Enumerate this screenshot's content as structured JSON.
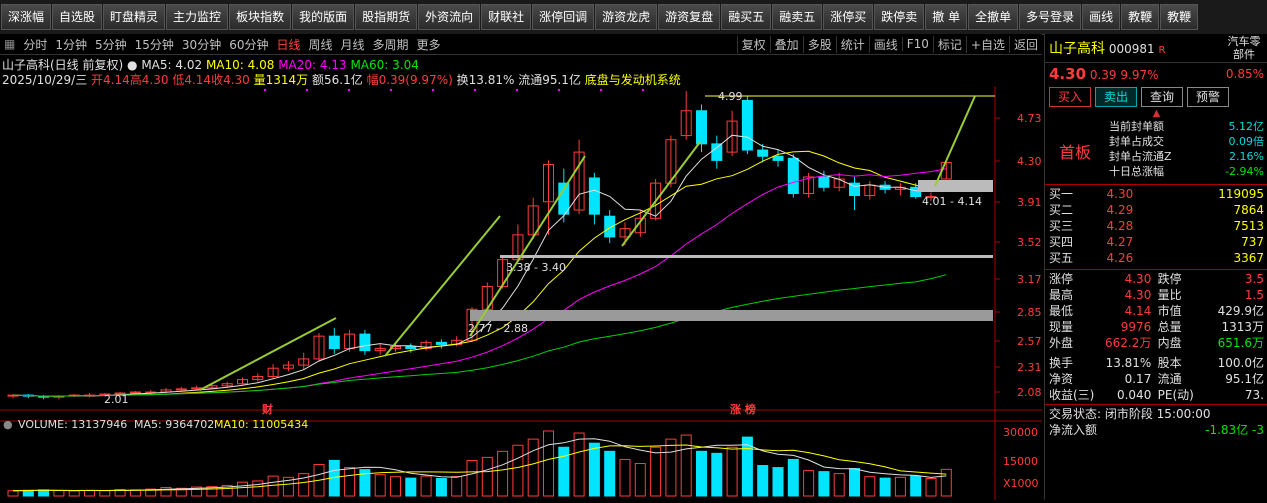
{
  "toolbar": [
    "深涨幅",
    "自选股",
    "盯盘精灵",
    "主力监控",
    "板块指数",
    "我的版面",
    "股指期货",
    "外资流向",
    "财联社",
    "涨停回调",
    "游资龙虎",
    "游资复盘",
    "融买五",
    "融卖五",
    "涨停买",
    "跌停卖",
    "撤 单",
    "全撤单",
    "多号登录",
    "画线",
    "教鞭",
    "教鞭"
  ],
  "tabs": [
    "分时",
    "1分钟",
    "5分钟",
    "15分钟",
    "30分钟",
    "60分钟",
    "日线",
    "周线",
    "月线",
    "多周期",
    "更多"
  ],
  "tabs_right": [
    "复权",
    "叠加",
    "多股",
    "统计",
    "画线",
    "F10",
    "标记",
    "+自选",
    "返回"
  ],
  "info": {
    "name": "山子高科(日线 前复权)",
    "ma5": "MA5: 4.02",
    "ma10": "MA10: 4.08",
    "ma20": "MA20: 4.13",
    "ma60": "MA60: 3.04",
    "date": "2025/10/29/三",
    "open": "开4.14",
    "high": "高4.30",
    "low": "低4.14",
    "close": "收4.30",
    "vol": "量1314万",
    "amount": "额56.1亿",
    "change": "幅0.39(9.97%)",
    "turnover": "换13.81%",
    "float": "流通95.1亿",
    "concept": "底盘与发动机系统"
  },
  "chart_data": {
    "type": "candlestick",
    "y_ticks": [
      "4.73",
      "4.30",
      "3.91",
      "3.52",
      "3.17",
      "2.85",
      "2.57",
      "2.31",
      "2.08"
    ],
    "vol_ticks": [
      "30000",
      "15000",
      "X1000"
    ],
    "annotations": [
      "4.99",
      "4.01 - 4.14",
      "3.38 - 3.40",
      "2.77 - 2.88",
      "2.01"
    ],
    "markers": [
      "财",
      "涨 榜"
    ],
    "volume_label": {
      "vol": "VOLUME: 13137946",
      "ma5": "MA5: 9364702",
      "ma10": "MA10: 11005434"
    },
    "candles": [
      {
        "o": 2.05,
        "c": 2.05,
        "h": 2.06,
        "l": 2.02,
        "v": 2600
      },
      {
        "o": 2.05,
        "c": 2.04,
        "h": 2.06,
        "l": 2.02,
        "v": 2800
      },
      {
        "o": 2.04,
        "c": 2.03,
        "h": 2.05,
        "l": 2.01,
        "v": 3000
      },
      {
        "o": 2.03,
        "c": 2.04,
        "h": 2.05,
        "l": 2.01,
        "v": 2700
      },
      {
        "o": 2.04,
        "c": 2.05,
        "h": 2.06,
        "l": 2.03,
        "v": 2500
      },
      {
        "o": 2.05,
        "c": 2.05,
        "h": 2.07,
        "l": 2.03,
        "v": 2700
      },
      {
        "o": 2.05,
        "c": 2.06,
        "h": 2.07,
        "l": 2.04,
        "v": 2600
      },
      {
        "o": 2.06,
        "c": 2.07,
        "h": 2.08,
        "l": 2.05,
        "v": 3200
      },
      {
        "o": 2.07,
        "c": 2.08,
        "h": 2.09,
        "l": 2.06,
        "v": 3000
      },
      {
        "o": 2.08,
        "c": 2.08,
        "h": 2.1,
        "l": 2.06,
        "v": 3400
      },
      {
        "o": 2.08,
        "c": 2.1,
        "h": 2.12,
        "l": 2.07,
        "v": 4200
      },
      {
        "o": 2.1,
        "c": 2.11,
        "h": 2.13,
        "l": 2.09,
        "v": 3800
      },
      {
        "o": 2.11,
        "c": 2.12,
        "h": 2.14,
        "l": 2.1,
        "v": 4400
      },
      {
        "o": 2.12,
        "c": 2.14,
        "h": 2.16,
        "l": 2.11,
        "v": 4600
      },
      {
        "o": 2.14,
        "c": 2.16,
        "h": 2.18,
        "l": 2.13,
        "v": 5200
      },
      {
        "o": 2.16,
        "c": 2.2,
        "h": 2.22,
        "l": 2.15,
        "v": 6800
      },
      {
        "o": 2.2,
        "c": 2.23,
        "h": 2.26,
        "l": 2.18,
        "v": 7400
      },
      {
        "o": 2.23,
        "c": 2.31,
        "h": 2.35,
        "l": 2.21,
        "v": 9800
      },
      {
        "o": 2.31,
        "c": 2.34,
        "h": 2.38,
        "l": 2.28,
        "v": 9200
      },
      {
        "o": 2.34,
        "c": 2.4,
        "h": 2.46,
        "l": 2.3,
        "v": 11000
      },
      {
        "o": 2.4,
        "c": 2.62,
        "h": 2.65,
        "l": 2.38,
        "v": 15500
      },
      {
        "o": 2.62,
        "c": 2.5,
        "h": 2.7,
        "l": 2.45,
        "v": 17500
      },
      {
        "o": 2.5,
        "c": 2.64,
        "h": 2.68,
        "l": 2.47,
        "v": 14000
      },
      {
        "o": 2.64,
        "c": 2.48,
        "h": 2.68,
        "l": 2.44,
        "v": 13000
      },
      {
        "o": 2.48,
        "c": 2.5,
        "h": 2.55,
        "l": 2.44,
        "v": 10500
      },
      {
        "o": 2.5,
        "c": 2.52,
        "h": 2.56,
        "l": 2.47,
        "v": 9500
      },
      {
        "o": 2.52,
        "c": 2.5,
        "h": 2.55,
        "l": 2.46,
        "v": 8800
      },
      {
        "o": 2.5,
        "c": 2.56,
        "h": 2.58,
        "l": 2.48,
        "v": 9800
      },
      {
        "o": 2.56,
        "c": 2.54,
        "h": 2.59,
        "l": 2.5,
        "v": 8600
      },
      {
        "o": 2.54,
        "c": 2.58,
        "h": 2.62,
        "l": 2.52,
        "v": 9600
      },
      {
        "o": 2.58,
        "c": 2.88,
        "h": 2.9,
        "l": 2.57,
        "v": 17500
      },
      {
        "o": 2.88,
        "c": 3.1,
        "h": 3.14,
        "l": 2.86,
        "v": 19000
      },
      {
        "o": 3.1,
        "c": 3.36,
        "h": 3.4,
        "l": 3.08,
        "v": 22000
      },
      {
        "o": 3.36,
        "c": 3.6,
        "h": 3.7,
        "l": 3.34,
        "v": 25000
      },
      {
        "o": 3.6,
        "c": 3.88,
        "h": 3.96,
        "l": 3.56,
        "v": 28000
      },
      {
        "o": 3.92,
        "c": 4.28,
        "h": 4.32,
        "l": 3.6,
        "v": 32000
      },
      {
        "o": 4.1,
        "c": 3.8,
        "h": 4.24,
        "l": 3.72,
        "v": 24000
      },
      {
        "o": 3.84,
        "c": 4.4,
        "h": 4.52,
        "l": 3.8,
        "v": 31000
      },
      {
        "o": 4.15,
        "c": 3.8,
        "h": 4.2,
        "l": 3.7,
        "v": 26000
      },
      {
        "o": 3.78,
        "c": 3.58,
        "h": 3.84,
        "l": 3.52,
        "v": 22000
      },
      {
        "o": 3.58,
        "c": 3.66,
        "h": 3.72,
        "l": 3.5,
        "v": 18000
      },
      {
        "o": 3.62,
        "c": 3.76,
        "h": 3.84,
        "l": 3.58,
        "v": 16000
      },
      {
        "o": 3.76,
        "c": 4.1,
        "h": 4.14,
        "l": 3.74,
        "v": 24000
      },
      {
        "o": 4.1,
        "c": 4.52,
        "h": 4.56,
        "l": 4.06,
        "v": 28000
      },
      {
        "o": 4.56,
        "c": 4.8,
        "h": 4.99,
        "l": 4.52,
        "v": 30000
      },
      {
        "o": 4.8,
        "c": 4.48,
        "h": 4.86,
        "l": 4.4,
        "v": 22000
      },
      {
        "o": 4.48,
        "c": 4.32,
        "h": 4.56,
        "l": 4.24,
        "v": 21000
      },
      {
        "o": 4.4,
        "c": 4.7,
        "h": 4.8,
        "l": 4.36,
        "v": 24000
      },
      {
        "o": 4.9,
        "c": 4.42,
        "h": 4.94,
        "l": 4.38,
        "v": 29000
      },
      {
        "o": 4.42,
        "c": 4.36,
        "h": 4.48,
        "l": 4.3,
        "v": 15000
      },
      {
        "o": 4.36,
        "c": 4.32,
        "h": 4.42,
        "l": 4.26,
        "v": 14000
      },
      {
        "o": 4.34,
        "c": 4.0,
        "h": 4.38,
        "l": 3.96,
        "v": 18000
      },
      {
        "o": 4.0,
        "c": 4.16,
        "h": 4.2,
        "l": 3.96,
        "v": 12500
      },
      {
        "o": 4.16,
        "c": 4.06,
        "h": 4.22,
        "l": 4.02,
        "v": 12000
      },
      {
        "o": 4.06,
        "c": 4.14,
        "h": 4.2,
        "l": 4.02,
        "v": 11000
      },
      {
        "o": 4.1,
        "c": 3.98,
        "h": 4.16,
        "l": 3.84,
        "v": 13500
      },
      {
        "o": 3.98,
        "c": 4.08,
        "h": 4.12,
        "l": 3.94,
        "v": 9500
      },
      {
        "o": 4.08,
        "c": 4.04,
        "h": 4.12,
        "l": 4.0,
        "v": 8800
      },
      {
        "o": 4.04,
        "c": 4.06,
        "h": 4.1,
        "l": 3.98,
        "v": 9200
      },
      {
        "o": 4.06,
        "c": 3.97,
        "h": 4.1,
        "l": 3.95,
        "v": 9800
      },
      {
        "o": 3.97,
        "c": 3.97,
        "h": 4.01,
        "l": 3.93,
        "v": 8600
      },
      {
        "o": 4.14,
        "c": 4.3,
        "h": 4.3,
        "l": 4.14,
        "v": 13137
      }
    ]
  },
  "right": {
    "name": "山子高科",
    "code": "000981",
    "tag": "R",
    "price": "4.30",
    "chg": "0.39",
    "pct": "9.97%",
    "sector_name": "汽车零部件",
    "sector_pct": "0.85%",
    "btn_buy": "买入",
    "btn_sell": "卖出",
    "btn_query": "查询",
    "btn_warn": "预警",
    "first_board": "首板",
    "seal": [
      {
        "k": "当前封单额",
        "v": "5.12亿"
      },
      {
        "k": "封单占成交",
        "v": "0.09倍"
      },
      {
        "k": "封单占流通Z",
        "v": "2.16%"
      },
      {
        "k": "十日总涨幅",
        "v": "-2.94%"
      }
    ],
    "bids": [
      {
        "k": "买一",
        "p": "4.30",
        "v": "119095"
      },
      {
        "k": "买二",
        "p": "4.29",
        "v": "7864"
      },
      {
        "k": "买三",
        "p": "4.28",
        "v": "7513"
      },
      {
        "k": "买四",
        "p": "4.27",
        "v": "737"
      },
      {
        "k": "买五",
        "p": "4.26",
        "v": "3367"
      }
    ],
    "stats": [
      [
        "涨停",
        "4.30",
        "跌停",
        "3.5"
      ],
      [
        "最高",
        "4.30",
        "量比",
        "1.5"
      ],
      [
        "最低",
        "4.14",
        "市值",
        "429.9亿"
      ],
      [
        "现量",
        "9976",
        "总量",
        "1313万"
      ],
      [
        "外盘",
        "662.2万",
        "内盘",
        "651.6万"
      ],
      [
        "换手",
        "13.81%",
        "股本",
        "100.0亿"
      ],
      [
        "净资",
        "0.17",
        "流通",
        "95.1亿"
      ],
      [
        "收益(三)",
        "0.040",
        "PE(动)",
        "73."
      ]
    ],
    "status": "交易状态: 闭市阶段 15:00:00",
    "netflow_label": "净流入额",
    "netflow": "-1.83亿",
    "netflow2": "-3"
  }
}
